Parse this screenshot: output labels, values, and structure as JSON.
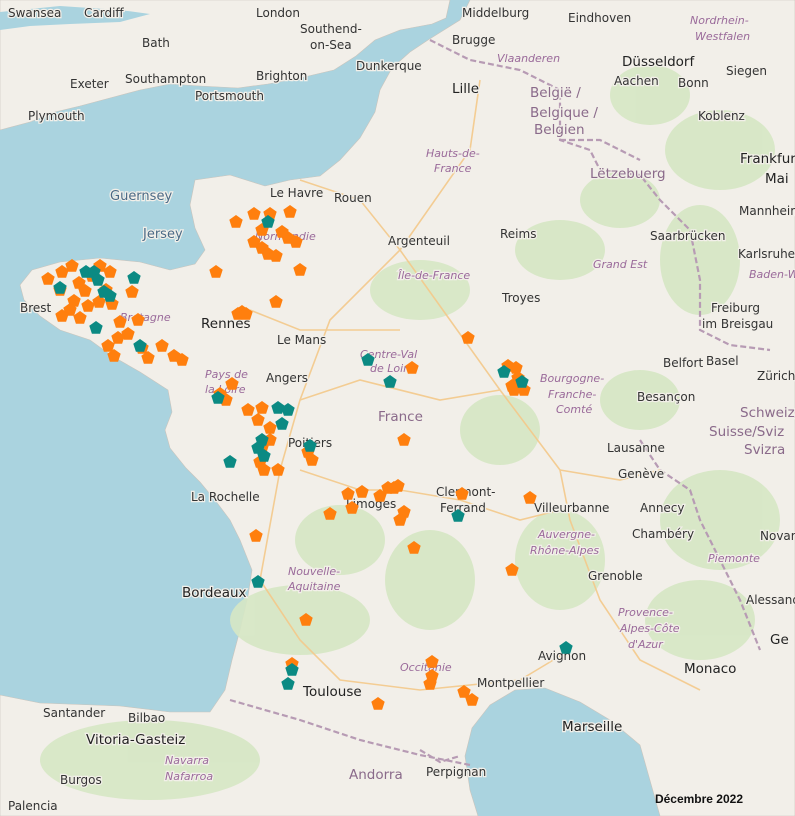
{
  "colors": {
    "sea": "#aad3df",
    "land": "#f2efe9",
    "forest": "#d6e7c4",
    "border": "#b79bb4",
    "road": "#f4c98a",
    "marker_orange": "#ff7f0e",
    "marker_teal": "#0b8a83"
  },
  "caption": "Décembre 2022",
  "labels": [
    {
      "id": "swansea",
      "text": "Swansea",
      "cls": "city"
    },
    {
      "id": "cardiff",
      "text": "Cardiff",
      "cls": "city"
    },
    {
      "id": "london",
      "text": "London",
      "cls": "city"
    },
    {
      "id": "southend",
      "text": "Southend-",
      "cls": "city"
    },
    {
      "id": "onsea",
      "text": "on-Sea",
      "cls": "city"
    },
    {
      "id": "middelburg",
      "text": "Middelburg",
      "cls": "city"
    },
    {
      "id": "eindhoven",
      "text": "Eindhoven",
      "cls": "city"
    },
    {
      "id": "nordrhein",
      "text": "Nordrhein-",
      "cls": "region"
    },
    {
      "id": "westfalen",
      "text": "Westfalen",
      "cls": "region"
    },
    {
      "id": "bath",
      "text": "Bath",
      "cls": "city"
    },
    {
      "id": "brugge",
      "text": "Brugge",
      "cls": "city"
    },
    {
      "id": "vlaanderen",
      "text": "Vlaanderen",
      "cls": "region"
    },
    {
      "id": "dusseldorf",
      "text": "Düsseldorf",
      "cls": "bigcity"
    },
    {
      "id": "exeter",
      "text": "Exeter",
      "cls": "city"
    },
    {
      "id": "southampton",
      "text": "Southampton",
      "cls": "city"
    },
    {
      "id": "brighton",
      "text": "Brighton",
      "cls": "city"
    },
    {
      "id": "dunkerque",
      "text": "Dunkerque",
      "cls": "city"
    },
    {
      "id": "aachen",
      "text": "Aachen",
      "cls": "city"
    },
    {
      "id": "bonn",
      "text": "Bonn",
      "cls": "city"
    },
    {
      "id": "siegen",
      "text": "Siegen",
      "cls": "city"
    },
    {
      "id": "plymouth",
      "text": "Plymouth",
      "cls": "city"
    },
    {
      "id": "portsmouth",
      "text": "Portsmouth",
      "cls": "city"
    },
    {
      "id": "lille",
      "text": "Lille",
      "cls": "bigcity"
    },
    {
      "id": "belgie",
      "text": "België /",
      "cls": "country"
    },
    {
      "id": "belgique",
      "text": "Belgique /",
      "cls": "country"
    },
    {
      "id": "belgien",
      "text": "Belgien",
      "cls": "country"
    },
    {
      "id": "koblenz",
      "text": "Koblenz",
      "cls": "city"
    },
    {
      "id": "hautsdefrance1",
      "text": "Hauts-de-",
      "cls": "region"
    },
    {
      "id": "hautsdefrance2",
      "text": "France",
      "cls": "region"
    },
    {
      "id": "letzebuerg",
      "text": "Lëtzebuerg",
      "cls": "country"
    },
    {
      "id": "frankfurt",
      "text": "Frankfur",
      "cls": "bigcity"
    },
    {
      "id": "mainz",
      "text": "Mai",
      "cls": "bigcity"
    },
    {
      "id": "guernsey",
      "text": "Guernsey",
      "cls": "island"
    },
    {
      "id": "lehavre",
      "text": "Le Havre",
      "cls": "city"
    },
    {
      "id": "rouen",
      "text": "Rouen",
      "cls": "city"
    },
    {
      "id": "mannheim",
      "text": "Mannheim",
      "cls": "city"
    },
    {
      "id": "jersey",
      "text": "Jersey",
      "cls": "island"
    },
    {
      "id": "argenteuil",
      "text": "Argenteuil",
      "cls": "city"
    },
    {
      "id": "reims",
      "text": "Reims",
      "cls": "city"
    },
    {
      "id": "saarbrucken",
      "text": "Saarbrücken",
      "cls": "city"
    },
    {
      "id": "normandie",
      "text": "Normandie",
      "cls": "region"
    },
    {
      "id": "karlsruhe",
      "text": "Karlsruhe",
      "cls": "city"
    },
    {
      "id": "iledefrance",
      "text": "Île-de-France",
      "cls": "region"
    },
    {
      "id": "grandest",
      "text": "Grand Est",
      "cls": "region"
    },
    {
      "id": "badenw",
      "text": "Baden-W",
      "cls": "region"
    },
    {
      "id": "brest",
      "text": "Brest",
      "cls": "city"
    },
    {
      "id": "troyes",
      "text": "Troyes",
      "cls": "city"
    },
    {
      "id": "freiburg",
      "text": "Freiburg",
      "cls": "city"
    },
    {
      "id": "breisgau",
      "text": "im Breisgau",
      "cls": "city"
    },
    {
      "id": "bretagne",
      "text": "Bretagne",
      "cls": "region"
    },
    {
      "id": "rennes",
      "text": "Rennes",
      "cls": "bigcity"
    },
    {
      "id": "lemans",
      "text": "Le Mans",
      "cls": "city"
    },
    {
      "id": "centreval1",
      "text": "Centre-Val",
      "cls": "region"
    },
    {
      "id": "centreval2",
      "text": "de Loire",
      "cls": "region"
    },
    {
      "id": "belfort",
      "text": "Belfort",
      "cls": "city"
    },
    {
      "id": "basel",
      "text": "Basel",
      "cls": "city"
    },
    {
      "id": "zurich",
      "text": "Zürich",
      "cls": "city"
    },
    {
      "id": "paysloire1",
      "text": "Pays de",
      "cls": "region"
    },
    {
      "id": "paysloire2",
      "text": "la Loire",
      "cls": "region"
    },
    {
      "id": "angers",
      "text": "Angers",
      "cls": "city"
    },
    {
      "id": "bourgogne1",
      "text": "Bourgogne-",
      "cls": "region"
    },
    {
      "id": "bourgogne2",
      "text": "Franche-",
      "cls": "region"
    },
    {
      "id": "bourgogne3",
      "text": "Comté",
      "cls": "region"
    },
    {
      "id": "besancon",
      "text": "Besançon",
      "cls": "city"
    },
    {
      "id": "france",
      "text": "France",
      "cls": "country"
    },
    {
      "id": "schweiz",
      "text": "Schweiz/",
      "cls": "country"
    },
    {
      "id": "suisse",
      "text": "Suisse/Sviz",
      "cls": "country"
    },
    {
      "id": "svizra",
      "text": "Svizra",
      "cls": "country"
    },
    {
      "id": "poitiers",
      "text": "Poitiers",
      "cls": "city"
    },
    {
      "id": "lausanne",
      "text": "Lausanne",
      "cls": "city"
    },
    {
      "id": "clermont1",
      "text": "Clermont-",
      "cls": "city"
    },
    {
      "id": "clermont2",
      "text": "Ferrand",
      "cls": "city"
    },
    {
      "id": "geneve",
      "text": "Genève",
      "cls": "city"
    },
    {
      "id": "larochelle",
      "text": "La Rochelle",
      "cls": "city"
    },
    {
      "id": "limoges",
      "text": "Limoges",
      "cls": "city"
    },
    {
      "id": "villeurbanne",
      "text": "Villeurbanne",
      "cls": "city"
    },
    {
      "id": "annecy",
      "text": "Annecy",
      "cls": "city"
    },
    {
      "id": "chambery",
      "text": "Chambéry",
      "cls": "city"
    },
    {
      "id": "novara",
      "text": "Novar",
      "cls": "city"
    },
    {
      "id": "auvergne1",
      "text": "Auvergne-",
      "cls": "region"
    },
    {
      "id": "auvergne2",
      "text": "Rhône-Alpes",
      "cls": "region"
    },
    {
      "id": "piemonte",
      "text": "Piemonte",
      "cls": "region"
    },
    {
      "id": "nouvelle1",
      "text": "Nouvelle-",
      "cls": "region"
    },
    {
      "id": "nouvelle2",
      "text": "Aquitaine",
      "cls": "region"
    },
    {
      "id": "grenoble",
      "text": "Grenoble",
      "cls": "city"
    },
    {
      "id": "bordeaux",
      "text": "Bordeaux",
      "cls": "bigcity"
    },
    {
      "id": "alessand",
      "text": "Alessand",
      "cls": "city"
    },
    {
      "id": "provence1",
      "text": "Provence-",
      "cls": "region"
    },
    {
      "id": "provence2",
      "text": "Alpes-Côte",
      "cls": "region"
    },
    {
      "id": "provence3",
      "text": "d'Azur",
      "cls": "region"
    },
    {
      "id": "avignon",
      "text": "Avignon",
      "cls": "city"
    },
    {
      "id": "ge",
      "text": "Ge",
      "cls": "bigcity"
    },
    {
      "id": "occitanie",
      "text": "Occitanie",
      "cls": "region"
    },
    {
      "id": "montpellier",
      "text": "Montpellier",
      "cls": "city"
    },
    {
      "id": "monaco",
      "text": "Monaco",
      "cls": "bigcity"
    },
    {
      "id": "toulouse",
      "text": "Toulouse",
      "cls": "bigcity"
    },
    {
      "id": "santander",
      "text": "Santander",
      "cls": "city"
    },
    {
      "id": "bilbao",
      "text": "Bilbao",
      "cls": "city"
    },
    {
      "id": "marseille",
      "text": "Marseille",
      "cls": "bigcity"
    },
    {
      "id": "vitoria",
      "text": "Vitoria-Gasteiz",
      "cls": "bigcity"
    },
    {
      "id": "navarra",
      "text": "Navarra",
      "cls": "region"
    },
    {
      "id": "nafarroa",
      "text": "Nafarroa",
      "cls": "region"
    },
    {
      "id": "andorra",
      "text": "Andorra",
      "cls": "country"
    },
    {
      "id": "perpignan",
      "text": "Perpignan",
      "cls": "city"
    },
    {
      "id": "burgos",
      "text": "Burgos",
      "cls": "city"
    },
    {
      "id": "palencia",
      "text": "Palencia",
      "cls": "city"
    }
  ]
}
